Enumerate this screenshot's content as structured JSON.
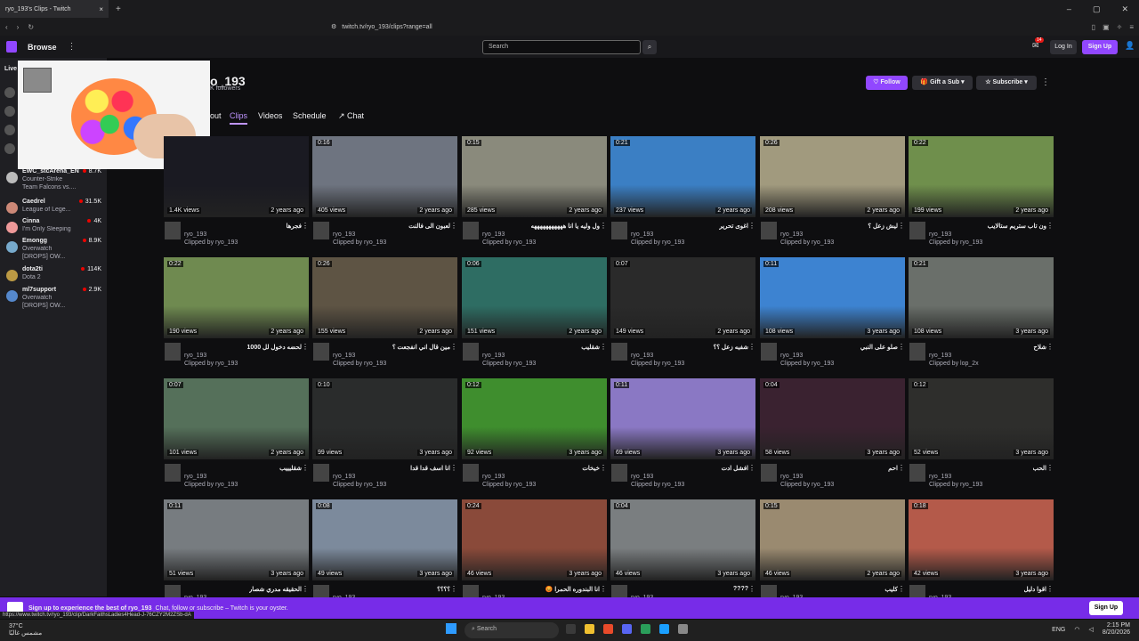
{
  "browser": {
    "tab_title": "ryo_193's Clips - Twitch",
    "url": "twitch.tv/ryo_193/clips?range=all",
    "status_url": "https://www.twitch.tv/ryo_193/clip/DarkFaithsLadies4Head-J-76CZY2M2ZSb-dA"
  },
  "nav": {
    "browse": "Browse",
    "search_placeholder": "Search",
    "notif_count": "14",
    "login": "Log In",
    "signup": "Sign Up"
  },
  "sidebar": {
    "live_header": "Live",
    "channels": [
      {
        "name": "EWC_stcArena_EN",
        "game": "Counter-Strike",
        "extra": "Team Falcons vs....",
        "viewers": "8.7K",
        "color": "#bbb"
      },
      {
        "name": "Caedrel",
        "game": "League of Lege...",
        "extra": "",
        "viewers": "31.5K",
        "color": "#c87"
      },
      {
        "name": "Cinna",
        "game": "I'm Only Sleeping",
        "extra": "",
        "viewers": "4K",
        "color": "#e99"
      },
      {
        "name": "Emongg",
        "game": "Overwatch",
        "extra": "[DROPS] OW...",
        "viewers": "8.9K",
        "color": "#7ac"
      },
      {
        "name": "dota2ti",
        "game": "Dota 2",
        "extra": "",
        "viewers": "114K",
        "color": "#b94"
      },
      {
        "name": "ml7support",
        "game": "Overwatch",
        "extra": "[DROPS] OW...",
        "viewers": "2.9K",
        "color": "#58c"
      }
    ]
  },
  "channel": {
    "name": "o_193",
    "followers": "K followers",
    "follow": "Follow",
    "gift": "Gift a Sub",
    "subscribe": "Subscribe",
    "tabs": [
      "out",
      "Clips",
      "Videos",
      "Schedule",
      "Chat"
    ]
  },
  "clips": [
    {
      "dur": "",
      "views": "1.4K views",
      "age": "2 years ago",
      "title": "فجرها",
      "channel": "ryo_193",
      "by": "Clipped by ryo_193",
      "bg": "#1a1a22"
    },
    {
      "dur": "0:16",
      "views": "405 views",
      "age": "2 years ago",
      "title": "لعبون الى فالنت",
      "channel": "ryo_193",
      "by": "Clipped by ryo_193",
      "bg": "#6e7480"
    },
    {
      "dur": "0:15",
      "views": "285 views",
      "age": "2 years ago",
      "title": "ول وليه يا انا هههههههههههه",
      "channel": "ryo_193",
      "by": "Clipped by ryo_193",
      "bg": "#8a8a7c"
    },
    {
      "dur": "0:21",
      "views": "237 views",
      "age": "2 years ago",
      "title": "اغوى تحرير",
      "channel": "ryo_193",
      "by": "Clipped by ryo_193",
      "bg": "#3b7fc4"
    },
    {
      "dur": "0:26",
      "views": "208 views",
      "age": "2 years ago",
      "title": "ليش زعل ؟",
      "channel": "ryo_193",
      "by": "Clipped by ryo_193",
      "bg": "#a19a7e"
    },
    {
      "dur": "0:22",
      "views": "199 views",
      "age": "2 years ago",
      "title": "ون تاب ستريم ستالايب",
      "channel": "ryo_193",
      "by": "Clipped by ryo_193",
      "bg": "#6f8f4c"
    },
    {
      "dur": "0:22",
      "views": "190 views",
      "age": "2 years ago",
      "title": "لحضه دخول لل 1000",
      "channel": "ryo_193",
      "by": "Clipped by ryo_193",
      "bg": "#6f8a50"
    },
    {
      "dur": "0:26",
      "views": "155 views",
      "age": "2 years ago",
      "title": "مين قال اني انفجعت ؟",
      "channel": "ryo_193",
      "by": "Clipped by ryo_193",
      "bg": "#5e5444"
    },
    {
      "dur": "0:06",
      "views": "151 views",
      "age": "2 years ago",
      "title": "شقليب",
      "channel": "ryo_193",
      "by": "Clipped by ryo_193",
      "bg": "#2e6d63"
    },
    {
      "dur": "0:07",
      "views": "149 views",
      "age": "2 years ago",
      "title": "شفيه زعل ؟؟",
      "channel": "ryo_193",
      "by": "Clipped by ryo_193",
      "bg": "#2a2a2a"
    },
    {
      "dur": "0:11",
      "views": "108 views",
      "age": "3 years ago",
      "title": "صلو على النبي",
      "channel": "ryo_193",
      "by": "Clipped by ryo_193",
      "bg": "#3d83d1"
    },
    {
      "dur": "0:21",
      "views": "108 views",
      "age": "3 years ago",
      "title": "شلاح",
      "channel": "ryo_193",
      "by": "Clipped by lop_2x",
      "bg": "#6a6f6a"
    },
    {
      "dur": "0:07",
      "views": "101 views",
      "age": "2 years ago",
      "title": "شقليييب",
      "channel": "ryo_193",
      "by": "Clipped by ryo_193",
      "bg": "#55705a"
    },
    {
      "dur": "0:10",
      "views": "99 views",
      "age": "3 years ago",
      "title": "انا اسف قدا قدا",
      "channel": "ryo_193",
      "by": "Clipped by ryo_193",
      "bg": "#2a2c2c"
    },
    {
      "dur": "0:12",
      "views": "92 views",
      "age": "3 years ago",
      "title": "خيخات",
      "channel": "ryo_193",
      "by": "Clipped by ryo_193",
      "bg": "#3f8e2e"
    },
    {
      "dur": "0:11",
      "views": "69 views",
      "age": "3 years ago",
      "title": "افشل ادت",
      "channel": "ryo_193",
      "by": "Clipped by ryo_193",
      "bg": "#8a78c4"
    },
    {
      "dur": "0:04",
      "views": "58 views",
      "age": "3 years ago",
      "title": "احم",
      "channel": "ryo_193",
      "by": "Clipped by ryo_193",
      "bg": "#3a2230"
    },
    {
      "dur": "0:12",
      "views": "52 views",
      "age": "3 years ago",
      "title": "الحب",
      "channel": "ryo_193",
      "by": "Clipped by ryo_193",
      "bg": "#2e2e2c"
    },
    {
      "dur": "0:11",
      "views": "51 views",
      "age": "3 years ago",
      "title": "الحقيقه مدري شصار",
      "channel": "ryo_193",
      "by": "",
      "bg": "#777c80"
    },
    {
      "dur": "0:08",
      "views": "49 views",
      "age": "3 years ago",
      "title": "؟؟؟؟",
      "channel": "ryo_193",
      "by": "",
      "bg": "#7c8a9c"
    },
    {
      "dur": "0:24",
      "views": "46 views",
      "age": "3 years ago",
      "title": "انا البندوره الحمرا 😡",
      "channel": "ryo_193",
      "by": "",
      "bg": "#8a4a3a"
    },
    {
      "dur": "0:04",
      "views": "46 views",
      "age": "3 years ago",
      "title": "????",
      "channel": "ryo_193",
      "by": "",
      "bg": "#7a7e80"
    },
    {
      "dur": "0:15",
      "views": "46 views",
      "age": "2 years ago",
      "title": "كليب",
      "channel": "ryo_193",
      "by": "",
      "bg": "#9a8a70"
    },
    {
      "dur": "0:18",
      "views": "42 views",
      "age": "3 years ago",
      "title": "اقوا دليل",
      "channel": "ryo_193",
      "by": "",
      "bg": "#b45a4a"
    }
  ],
  "banner": {
    "headline": "Sign up to experience the best of ryo_193",
    "sub": "Chat, follow or subscribe – Twitch is your oyster.",
    "button": "Sign Up"
  },
  "taskbar": {
    "temp": "37°C",
    "weather": "مشمس غالبًا",
    "search": "Search",
    "lang": "ENG",
    "time": "2:15 PM",
    "date": "8/20/2026"
  }
}
